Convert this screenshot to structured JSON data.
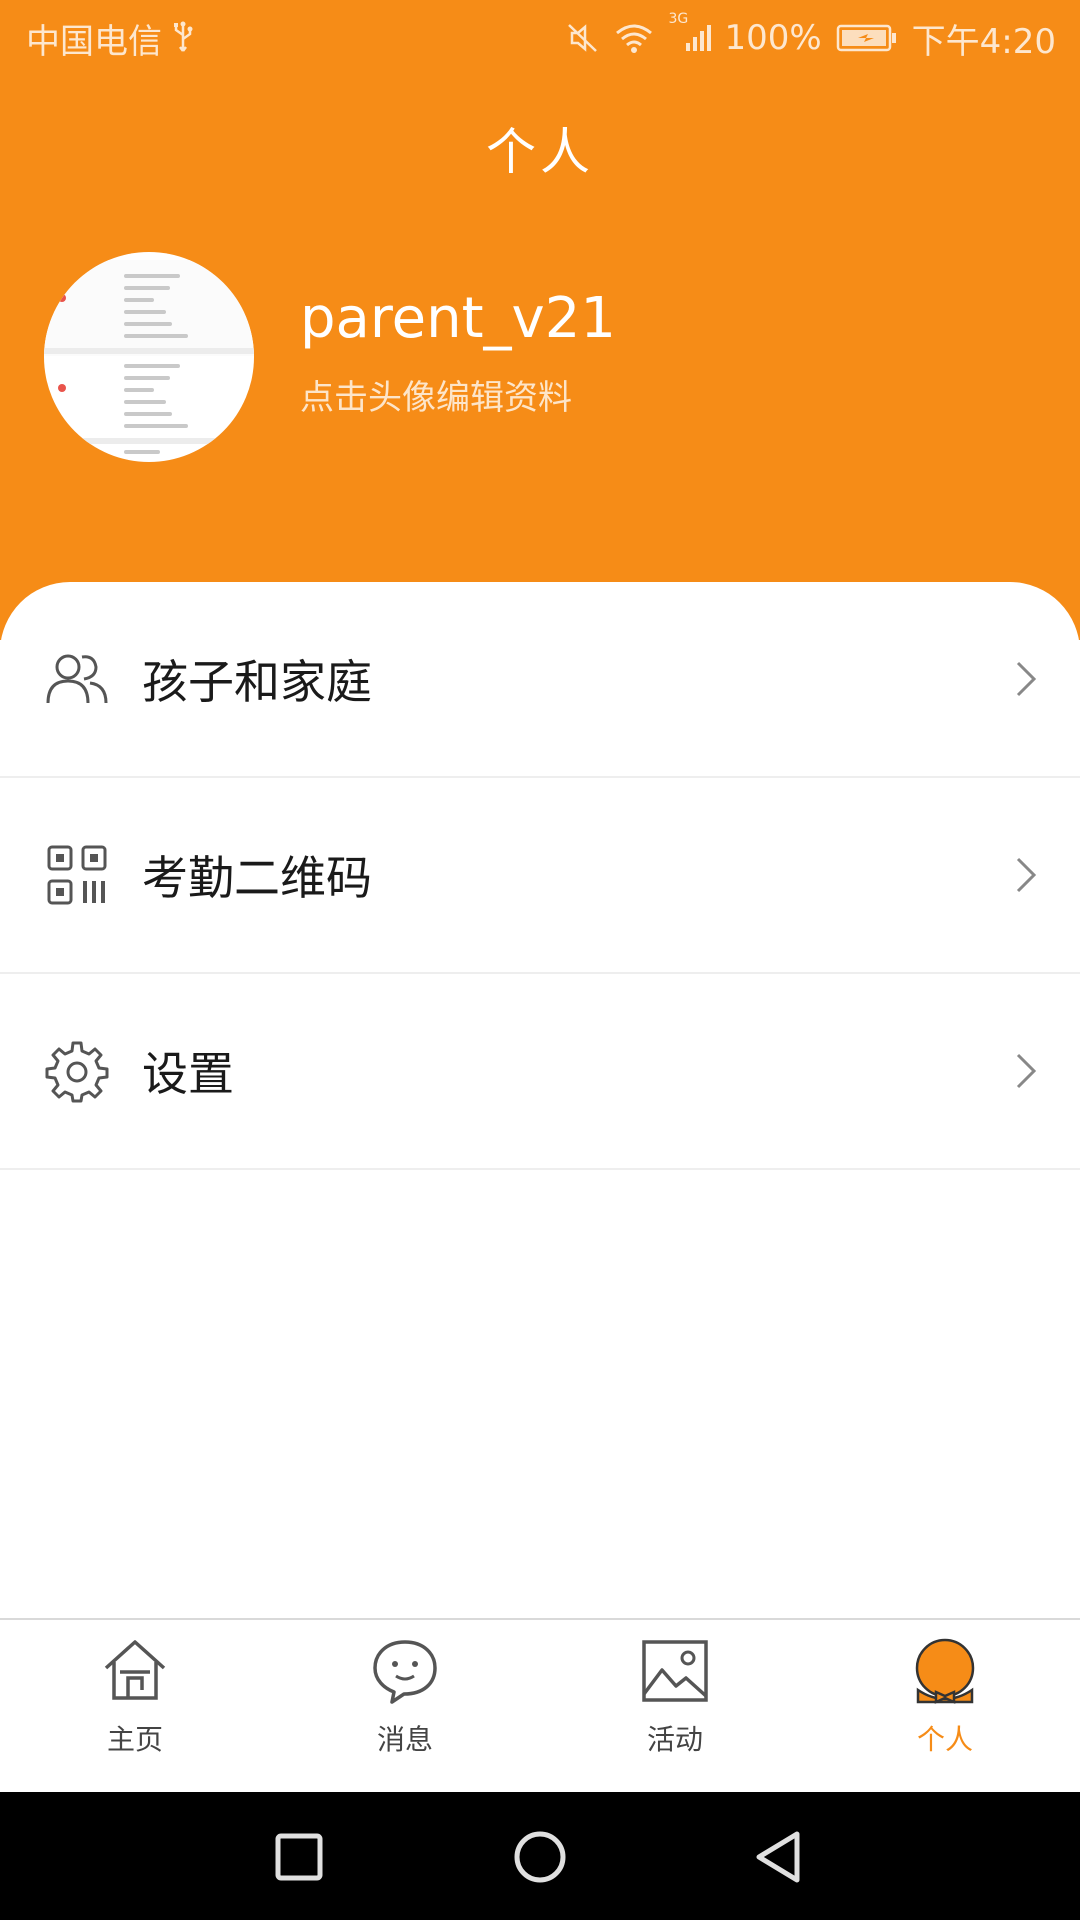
{
  "status_bar": {
    "carrier": "中国电信",
    "network_type": "3G",
    "battery": "100%",
    "time": "下午4:20"
  },
  "header": {
    "title": "个人"
  },
  "profile": {
    "username": "parent_v21",
    "edit_hint": "点击头像编辑资料"
  },
  "menu": {
    "items": [
      {
        "label": "孩子和家庭",
        "icon": "people-icon"
      },
      {
        "label": "考勤二维码",
        "icon": "qr-code-icon"
      },
      {
        "label": "设置",
        "icon": "gear-icon"
      }
    ]
  },
  "tabs": [
    {
      "label": "主页",
      "icon": "home-icon",
      "active": false
    },
    {
      "label": "消息",
      "icon": "chat-bubble-icon",
      "active": false
    },
    {
      "label": "活动",
      "icon": "image-icon",
      "active": false
    },
    {
      "label": "个人",
      "icon": "profile-mascot-icon",
      "active": true
    }
  ],
  "colors": {
    "accent": "#f68c17",
    "text_dark": "#1a1a1a",
    "tab_inactive": "#444444"
  }
}
